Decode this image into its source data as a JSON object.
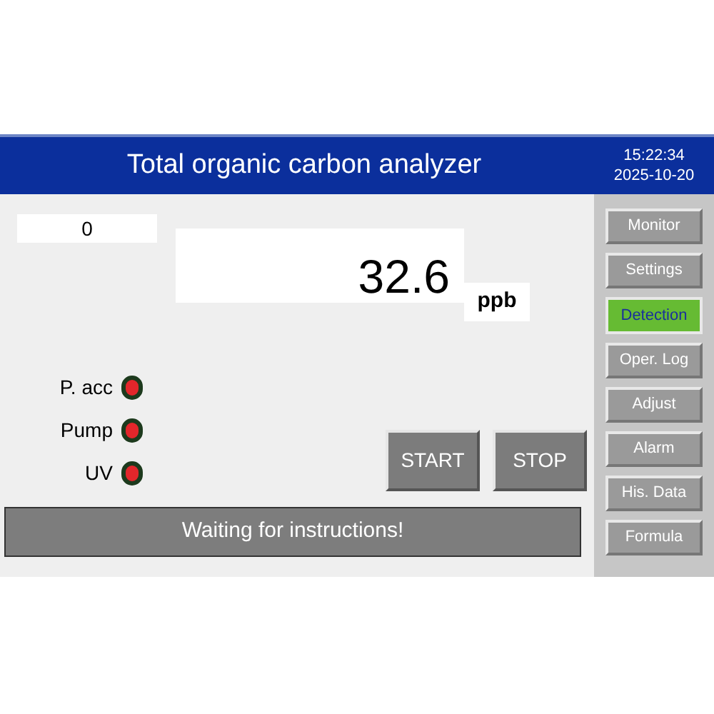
{
  "header": {
    "title": "Total organic carbon analyzer",
    "time": "15:22:34",
    "date": "2025-10-20"
  },
  "counter": "0",
  "reading": {
    "value": "32.6",
    "unit": "ppb"
  },
  "indicators": [
    {
      "label": "P. acc",
      "color": "#e3262b"
    },
    {
      "label": "Pump",
      "color": "#e3262b"
    },
    {
      "label": "UV",
      "color": "#e3262b"
    }
  ],
  "buttons": [
    "START",
    "STOP"
  ],
  "status_bar": "Waiting for instructions!",
  "nav": [
    {
      "label": "Monitor",
      "selected": false
    },
    {
      "label": "Settings",
      "selected": false
    },
    {
      "label": "Detection",
      "selected": true
    },
    {
      "label": "Oper. Log",
      "selected": false
    },
    {
      "label": "Adjust",
      "selected": false
    },
    {
      "label": "Alarm",
      "selected": false
    },
    {
      "label": "His. Data",
      "selected": false
    },
    {
      "label": "Formula",
      "selected": false
    }
  ]
}
